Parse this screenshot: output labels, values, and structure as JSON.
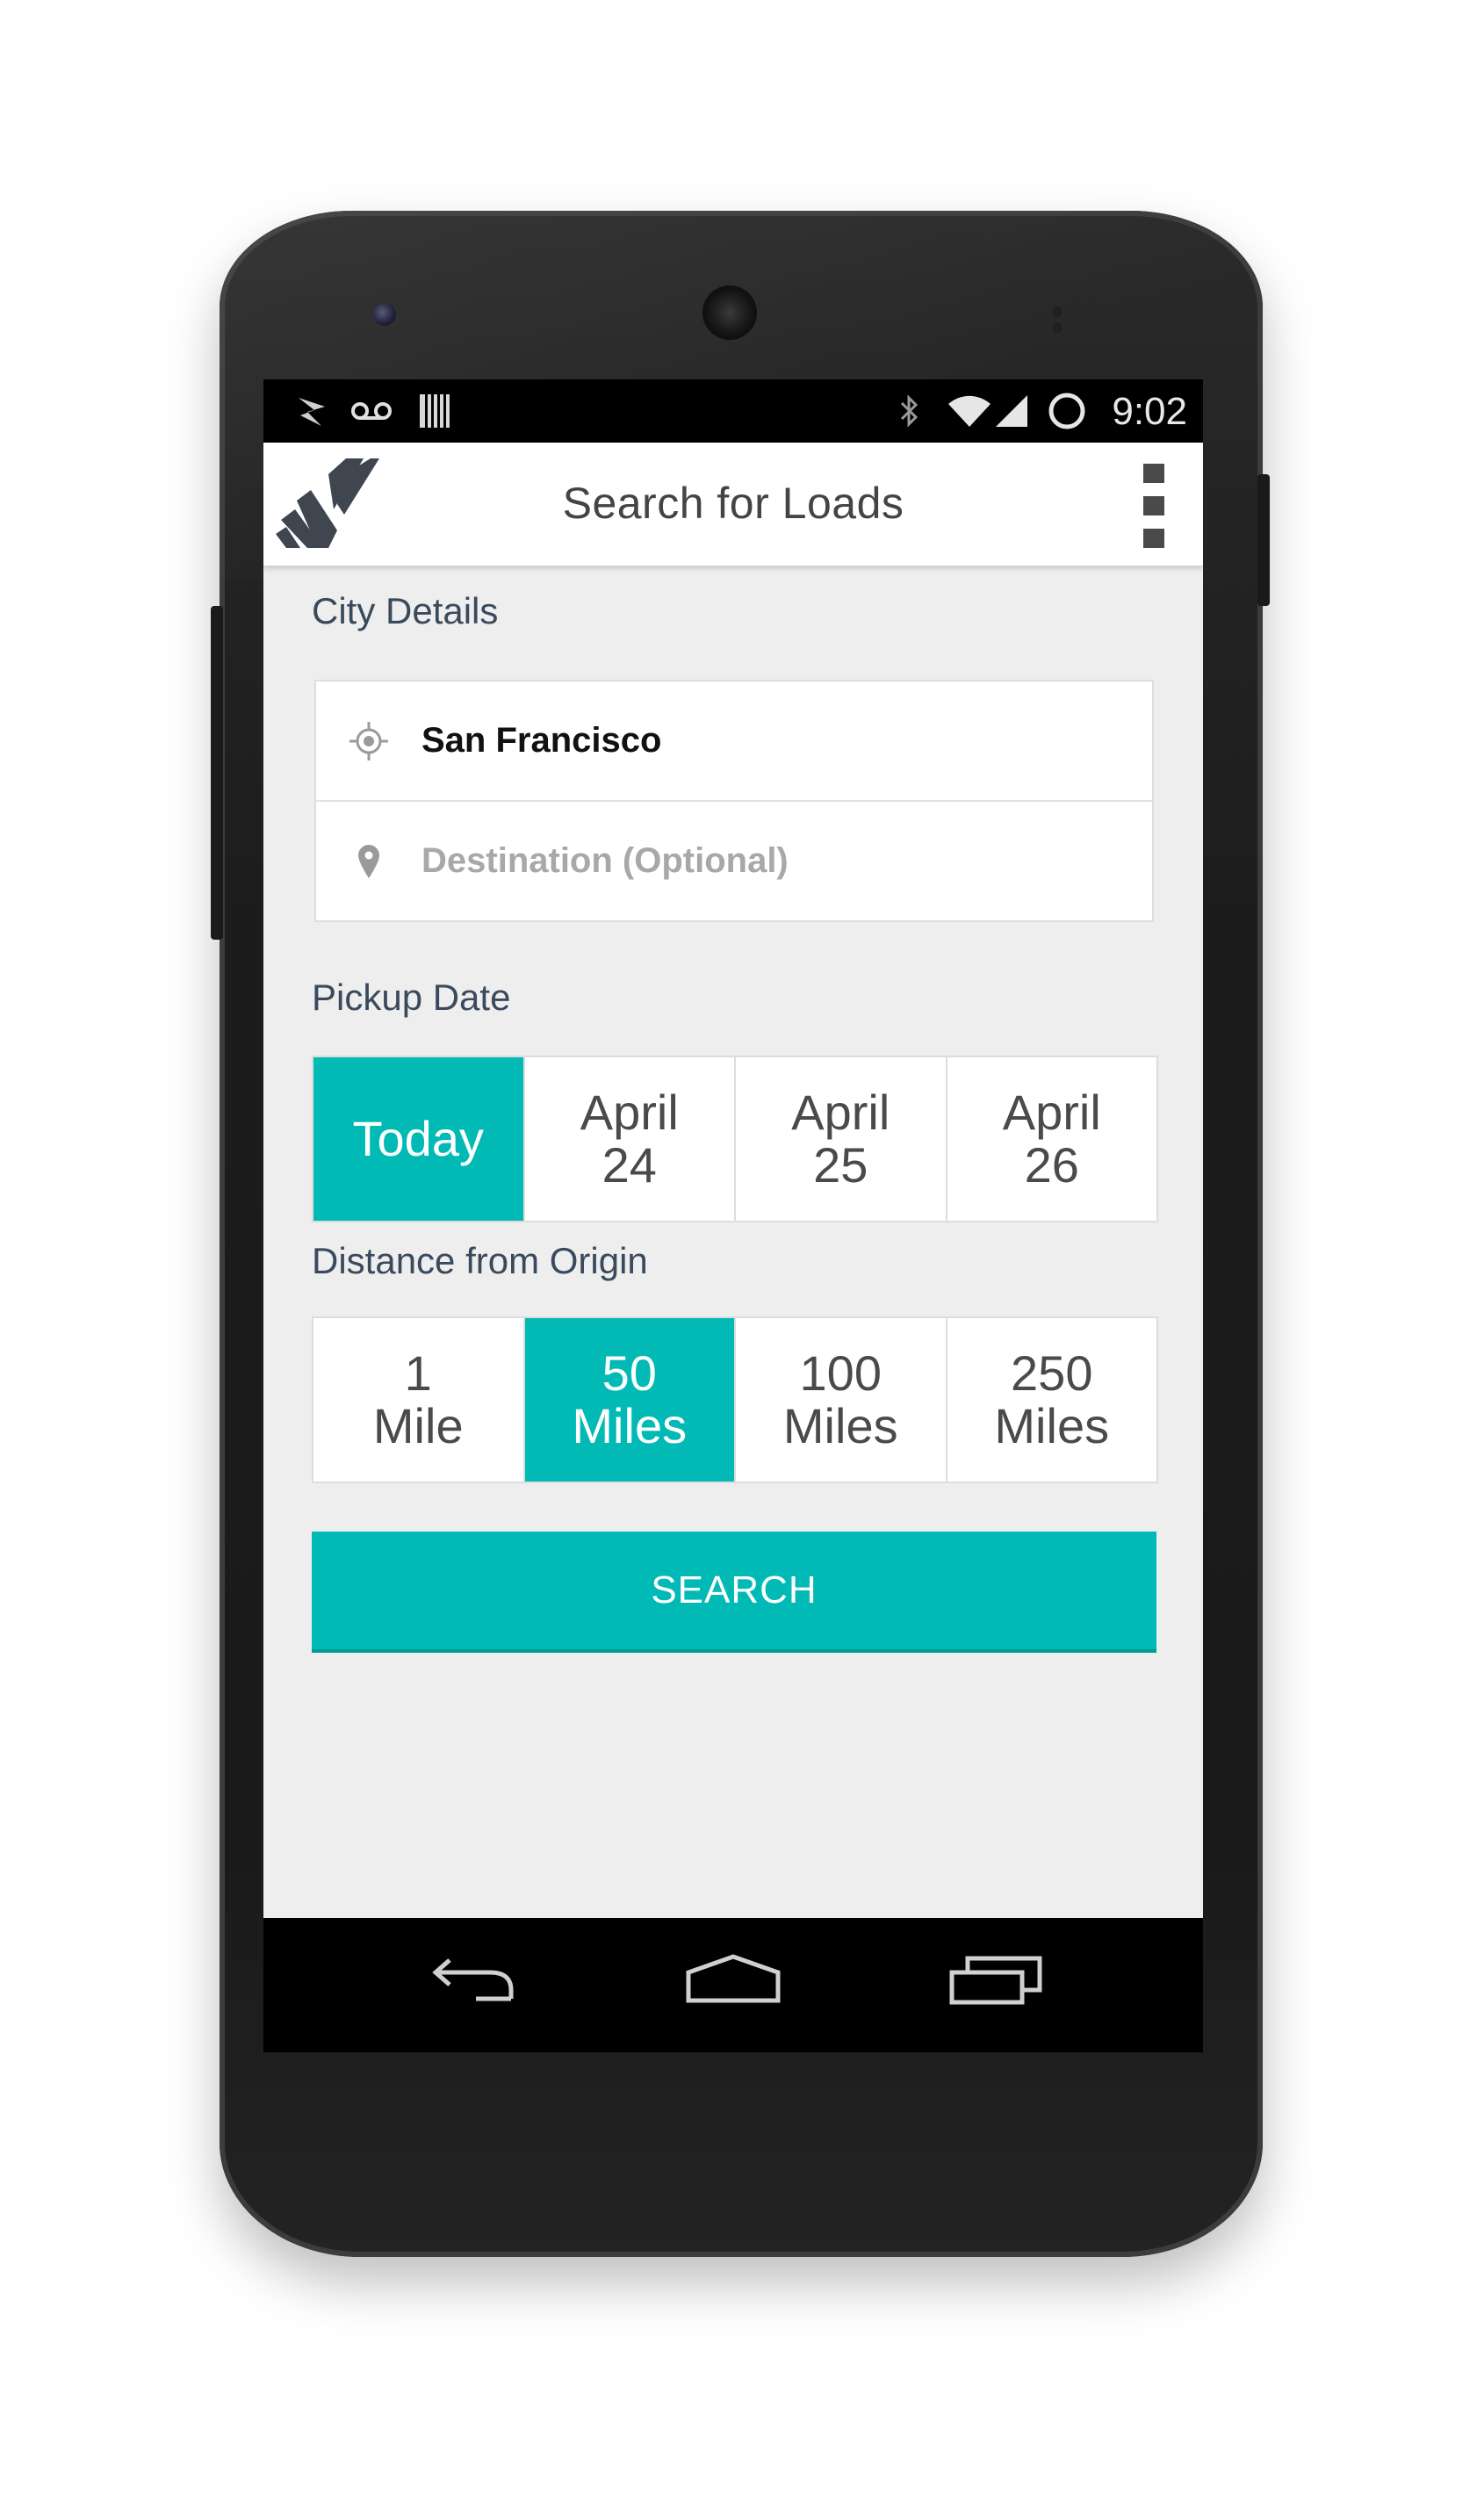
{
  "status_bar": {
    "time": "9:02",
    "left_icons": [
      "arrow-notification-icon",
      "voicemail-icon",
      "barcode-icon"
    ],
    "right_icons": [
      "bluetooth-icon",
      "wifi-icon",
      "signal-icon",
      "sync-circle-icon"
    ]
  },
  "app_bar": {
    "title": "Search for Loads",
    "logo": "app-logo-icon",
    "menu": "overflow-menu-icon"
  },
  "city_details": {
    "label": "City Details",
    "origin_value": "San Francisco",
    "destination_placeholder": "Destination (Optional)"
  },
  "pickup_date": {
    "label": "Pickup Date",
    "options": [
      {
        "line1": "Today",
        "line2": "",
        "selected": true
      },
      {
        "line1": "April",
        "line2": "24",
        "selected": false
      },
      {
        "line1": "April",
        "line2": "25",
        "selected": false
      },
      {
        "line1": "April",
        "line2": "26",
        "selected": false
      }
    ]
  },
  "distance": {
    "label": "Distance from Origin",
    "options": [
      {
        "line1": "1",
        "line2": "Mile",
        "selected": false
      },
      {
        "line1": "50",
        "line2": "Miles",
        "selected": true
      },
      {
        "line1": "100",
        "line2": "Miles",
        "selected": false
      },
      {
        "line1": "250",
        "line2": "Miles",
        "selected": false
      }
    ]
  },
  "search_button": {
    "label": "SEARCH"
  },
  "nav_bar": {
    "icons": [
      "back-icon",
      "home-icon",
      "recents-icon"
    ]
  },
  "colors": {
    "accent": "#02bab5",
    "background": "#eeeeee",
    "label": "#3a4a5c"
  }
}
